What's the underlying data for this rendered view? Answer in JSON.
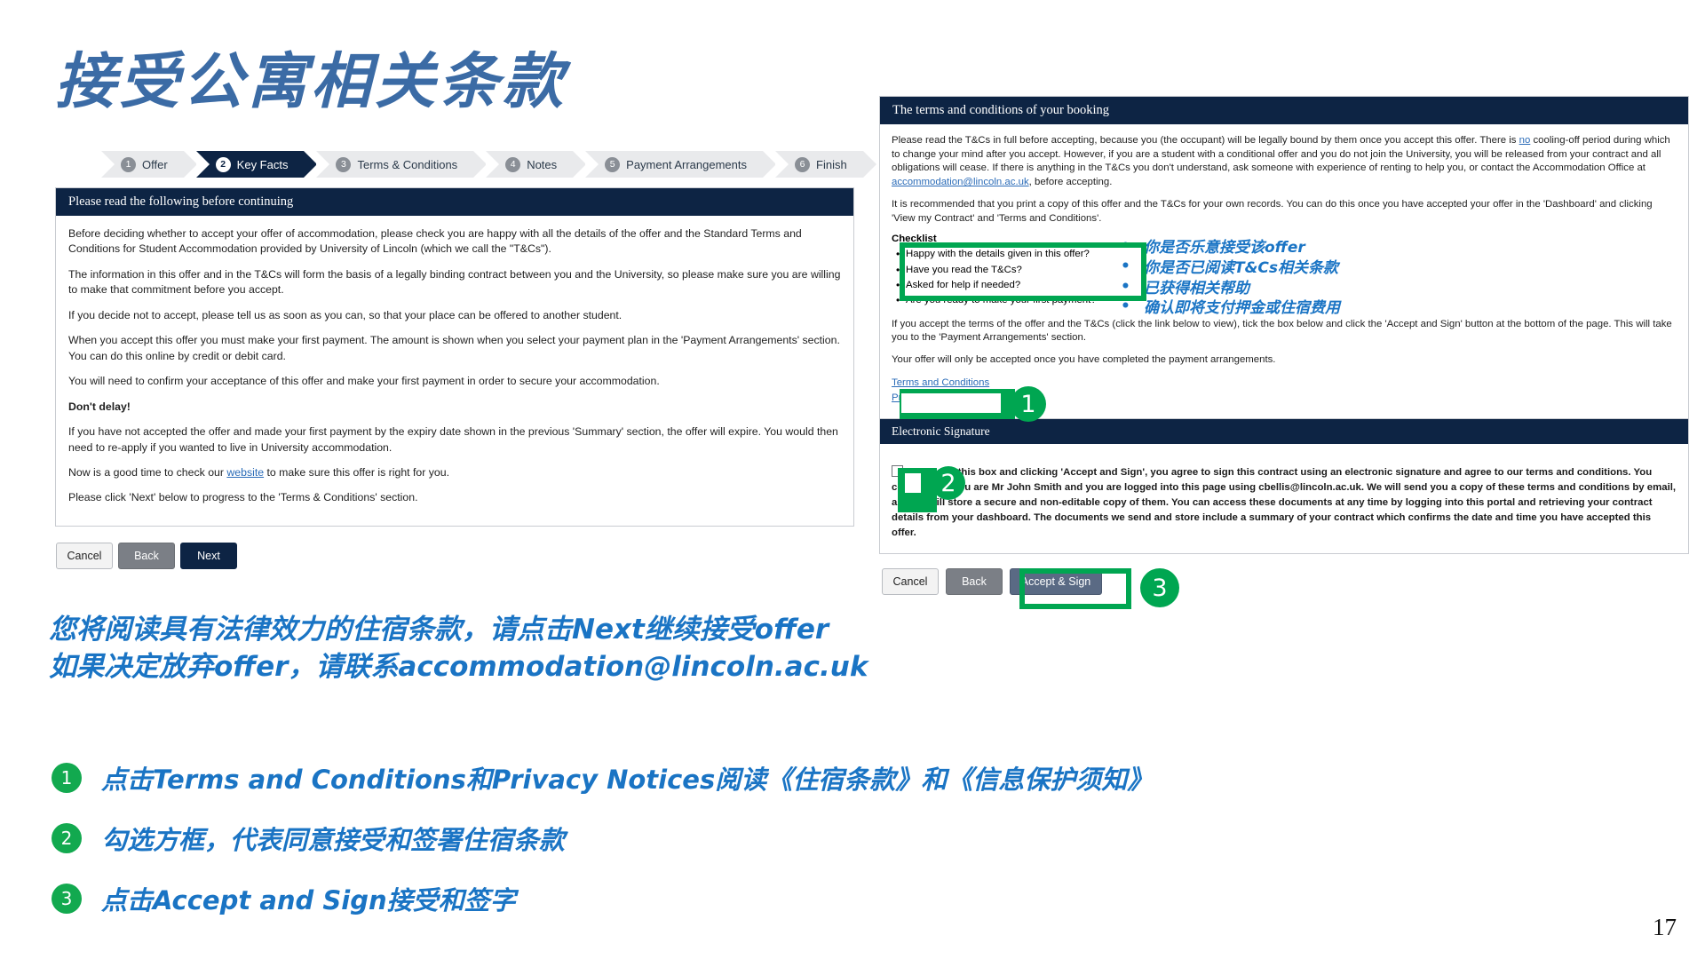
{
  "slide": {
    "title": "接受公寓相关条款",
    "page_number": "17",
    "accent_blue": "#1a74c4",
    "accent_green": "#00a651",
    "navy": "#0d2444"
  },
  "left_screen": {
    "steps": [
      {
        "num": "1",
        "label": "Offer",
        "active": false
      },
      {
        "num": "2",
        "label": "Key Facts",
        "active": true
      },
      {
        "num": "3",
        "label": "Terms & Conditions",
        "active": false
      },
      {
        "num": "4",
        "label": "Notes",
        "active": false
      },
      {
        "num": "5",
        "label": "Payment Arrangements",
        "active": false
      },
      {
        "num": "6",
        "label": "Finish",
        "active": false
      }
    ],
    "panel_title": "Please read the following before continuing",
    "paragraphs": [
      "Before deciding whether to accept your offer of accommodation, please check you are happy with all the details of the offer and the Standard Terms and Conditions for Student Accommodation provided by University of Lincoln (which we call the \"T&Cs\").",
      "The information in this offer and in the T&Cs will form the basis of a legally binding contract between you and the University, so please make sure you are willing to make that commitment before you accept.",
      "If you decide not to accept, please tell us as soon as you can, so that your place can be offered to another student.",
      "When you accept this offer you must make your first payment. The amount is shown when you select your payment plan in the 'Payment Arrangements' section. You can do this online by credit or debit card.",
      "You will need to confirm your acceptance of this offer and make your first payment in order to secure your accommodation."
    ],
    "dont_delay_heading": "Don't delay!",
    "paragraph_expiry": "If you have not accepted the offer and made your first payment by the expiry date shown in the previous 'Summary' section, the offer will expire. You would then need to re-apply if you wanted to live in University accommodation.",
    "website_line_before": "Now is a good time to check our ",
    "website_link": "website",
    "website_line_after": " to make sure this offer is right for you.",
    "paragraph_next": "Please click 'Next' below to progress to the 'Terms & Conditions' section.",
    "buttons": {
      "cancel": "Cancel",
      "back": "Back",
      "next": "Next"
    }
  },
  "right_screen": {
    "panel_title": "The terms and conditions of your booking",
    "para_1_a": "Please read the T&Cs in full before accepting, because you (the occupant) will be legally bound by them once you accept this offer. There is ",
    "para_1_no": "no",
    "para_1_b": " cooling-off period during which to change your mind after you accept. However, if you are a student with a conditional offer and you do not join the University, you will be released from your contract and all obligations will cease. If there is anything in the T&Cs you don't understand, ask someone with experience of renting to help you, or contact the Accommodation Office at ",
    "para_1_email": "accommodation@lincoln.ac.uk",
    "para_1_c": ", before accepting.",
    "para_2": "It is recommended that you print a copy of this offer and the T&Cs for your own records. You can do this once you have accepted your offer in the 'Dashboard' and clicking 'View my Contract' and 'Terms and Conditions'.",
    "checklist_label": "Checklist",
    "checklist": [
      "Happy with the details given in this offer?",
      "Have you read the T&Cs?",
      "Asked for help if needed?",
      "Are you ready to make your first payment?"
    ],
    "checklist_cn": [
      "你是否乐意接受该offer",
      "你是否已阅读T&Cs相关条款",
      "已获得相关帮助",
      "确认即将支付押金或住宿费用"
    ],
    "para_3": "If you accept the terms of the offer and the T&Cs (click the link below to view), tick the box below and click the 'Accept and Sign' button at the bottom of the page. This will take you to the 'Payment Arrangements' section.",
    "para_4": "Your offer will only be accepted once you have completed the payment arrangements.",
    "link_terms": "Terms and Conditions",
    "link_privacy": "Privacy Notice",
    "esig_title": "Electronic Signature",
    "esig_text": "By ticking this box and clicking 'Accept and Sign', you agree to sign this contract using an electronic signature and agree to our terms and conditions. You confirm that you are Mr John Smith and you are logged into this page using cbellis@lincoln.ac.uk. We will send you a copy of these terms and conditions by email, and we will store a secure and non-editable copy of them. You can access these documents at any time by logging into this portal and retrieving your contract details from your dashboard. The documents we send and store include a summary of your contract which confirms the date and time you have accepted this offer.",
    "buttons": {
      "cancel": "Cancel",
      "back": "Back",
      "accept_sign": "Accept & Sign"
    }
  },
  "annotations": {
    "callout_1": "1",
    "callout_2": "2",
    "callout_3": "3"
  },
  "note_cn": {
    "line1": "您将阅读具有法律效力的住宿条款，请点击Next继续接受offer",
    "line2": "如果决定放弃offer，请联系accommodation@lincoln.ac.uk"
  },
  "instructions": [
    {
      "num": "1",
      "text": "点击Terms and Conditions和Privacy Notices阅读《住宿条款》和《信息保护须知》"
    },
    {
      "num": "2",
      "text": "勾选方框，代表同意接受和签署住宿条款"
    },
    {
      "num": "3",
      "text": "点击Accept and Sign接受和签字"
    }
  ]
}
